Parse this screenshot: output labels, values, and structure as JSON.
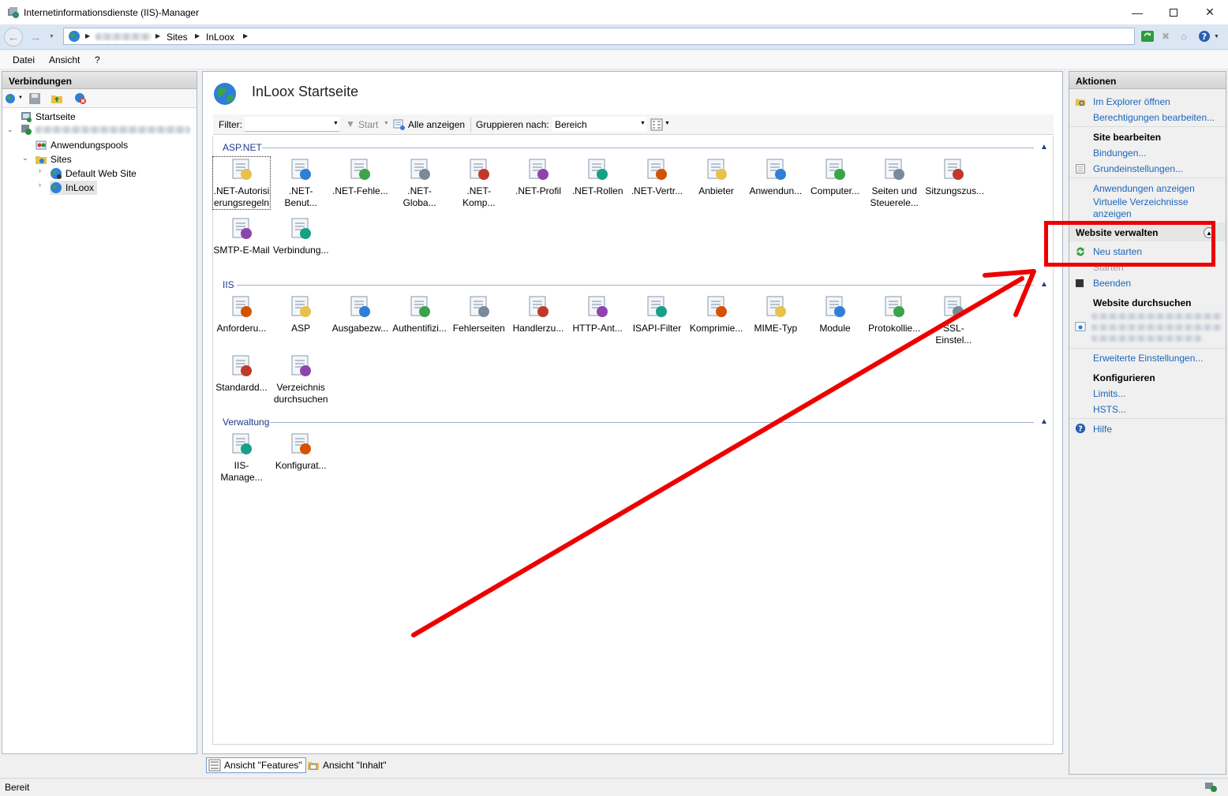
{
  "window": {
    "title": "Internetinformationsdienste (IIS)-Manager"
  },
  "address": {
    "crumbs": [
      "Sites",
      "InLoox"
    ]
  },
  "menu": {
    "items": [
      "Datei",
      "Ansicht",
      "?"
    ]
  },
  "connections": {
    "header": "Verbindungen",
    "tree": {
      "start": "Startseite",
      "app_pools": "Anwendungspools",
      "sites": "Sites",
      "default_site": "Default Web Site",
      "inloox": "InLoox"
    }
  },
  "center": {
    "title": "InLoox Startseite",
    "filter_label": "Filter:",
    "start_label": "Start",
    "show_all_label": "Alle anzeigen",
    "group_by_label": "Gruppieren nach:",
    "group_by_value": "Bereich",
    "groups": [
      {
        "name": "ASP.NET",
        "items": [
          [
            ".NET-Autorisi",
            "erungsregeln"
          ],
          [
            ".NET-Benut..."
          ],
          [
            ".NET-Fehle..."
          ],
          [
            ".NET-Globa..."
          ],
          [
            ".NET-Komp..."
          ],
          [
            ".NET-Profil"
          ],
          [
            ".NET-Rollen"
          ],
          [
            ".NET-Vertr..."
          ],
          [
            "Anbieter"
          ],
          [
            "Anwendun..."
          ],
          [
            "Computer..."
          ],
          [
            "Seiten und",
            "Steuerele..."
          ],
          [
            "Sitzungszus..."
          ],
          [
            "SMTP-E-Mail"
          ],
          [
            "Verbindung..."
          ]
        ]
      },
      {
        "name": "IIS",
        "items": [
          [
            "Anforderu..."
          ],
          [
            "ASP"
          ],
          [
            "Ausgabezw..."
          ],
          [
            "Authentifizi..."
          ],
          [
            "Fehlerseiten"
          ],
          [
            "Handlerzu..."
          ],
          [
            "HTTP-Ant..."
          ],
          [
            "ISAPI-Filter"
          ],
          [
            "Komprimie..."
          ],
          [
            "MIME-Typ"
          ],
          [
            "Module"
          ],
          [
            "Protokollie..."
          ],
          [
            "SSL-Einstel..."
          ],
          [
            "Standardd..."
          ],
          [
            "Verzeichnis",
            "durchsuchen"
          ]
        ]
      },
      {
        "name": "Verwaltung",
        "items": [
          [
            "IIS-Manage..."
          ],
          [
            "Konfigurat..."
          ]
        ]
      }
    ],
    "view_features": "Ansicht \"Features\"",
    "view_content": "Ansicht \"Inhalt\""
  },
  "actions": {
    "header": "Aktionen",
    "explore": "Im Explorer öffnen",
    "permissions": "Berechtigungen bearbeiten...",
    "edit_site_header": "Site bearbeiten",
    "bindings": "Bindungen...",
    "basic_settings": "Grundeinstellungen...",
    "view_apps": "Anwendungen anzeigen",
    "view_vdirs_1": "Virtuelle Verzeichnisse",
    "view_vdirs_2": "anzeigen",
    "manage_header": "Website verwalten",
    "restart": "Neu starten",
    "start": "Starten",
    "stop": "Beenden",
    "browse_header": "Website durchsuchen",
    "advanced": "Erweiterte Einstellungen...",
    "configure_header": "Konfigurieren",
    "limits": "Limits...",
    "hsts": "HSTS...",
    "help": "Hilfe"
  },
  "status": {
    "text": "Bereit"
  },
  "colors": {
    "accent": "#1c66b9",
    "annotation": "#ee0000"
  }
}
